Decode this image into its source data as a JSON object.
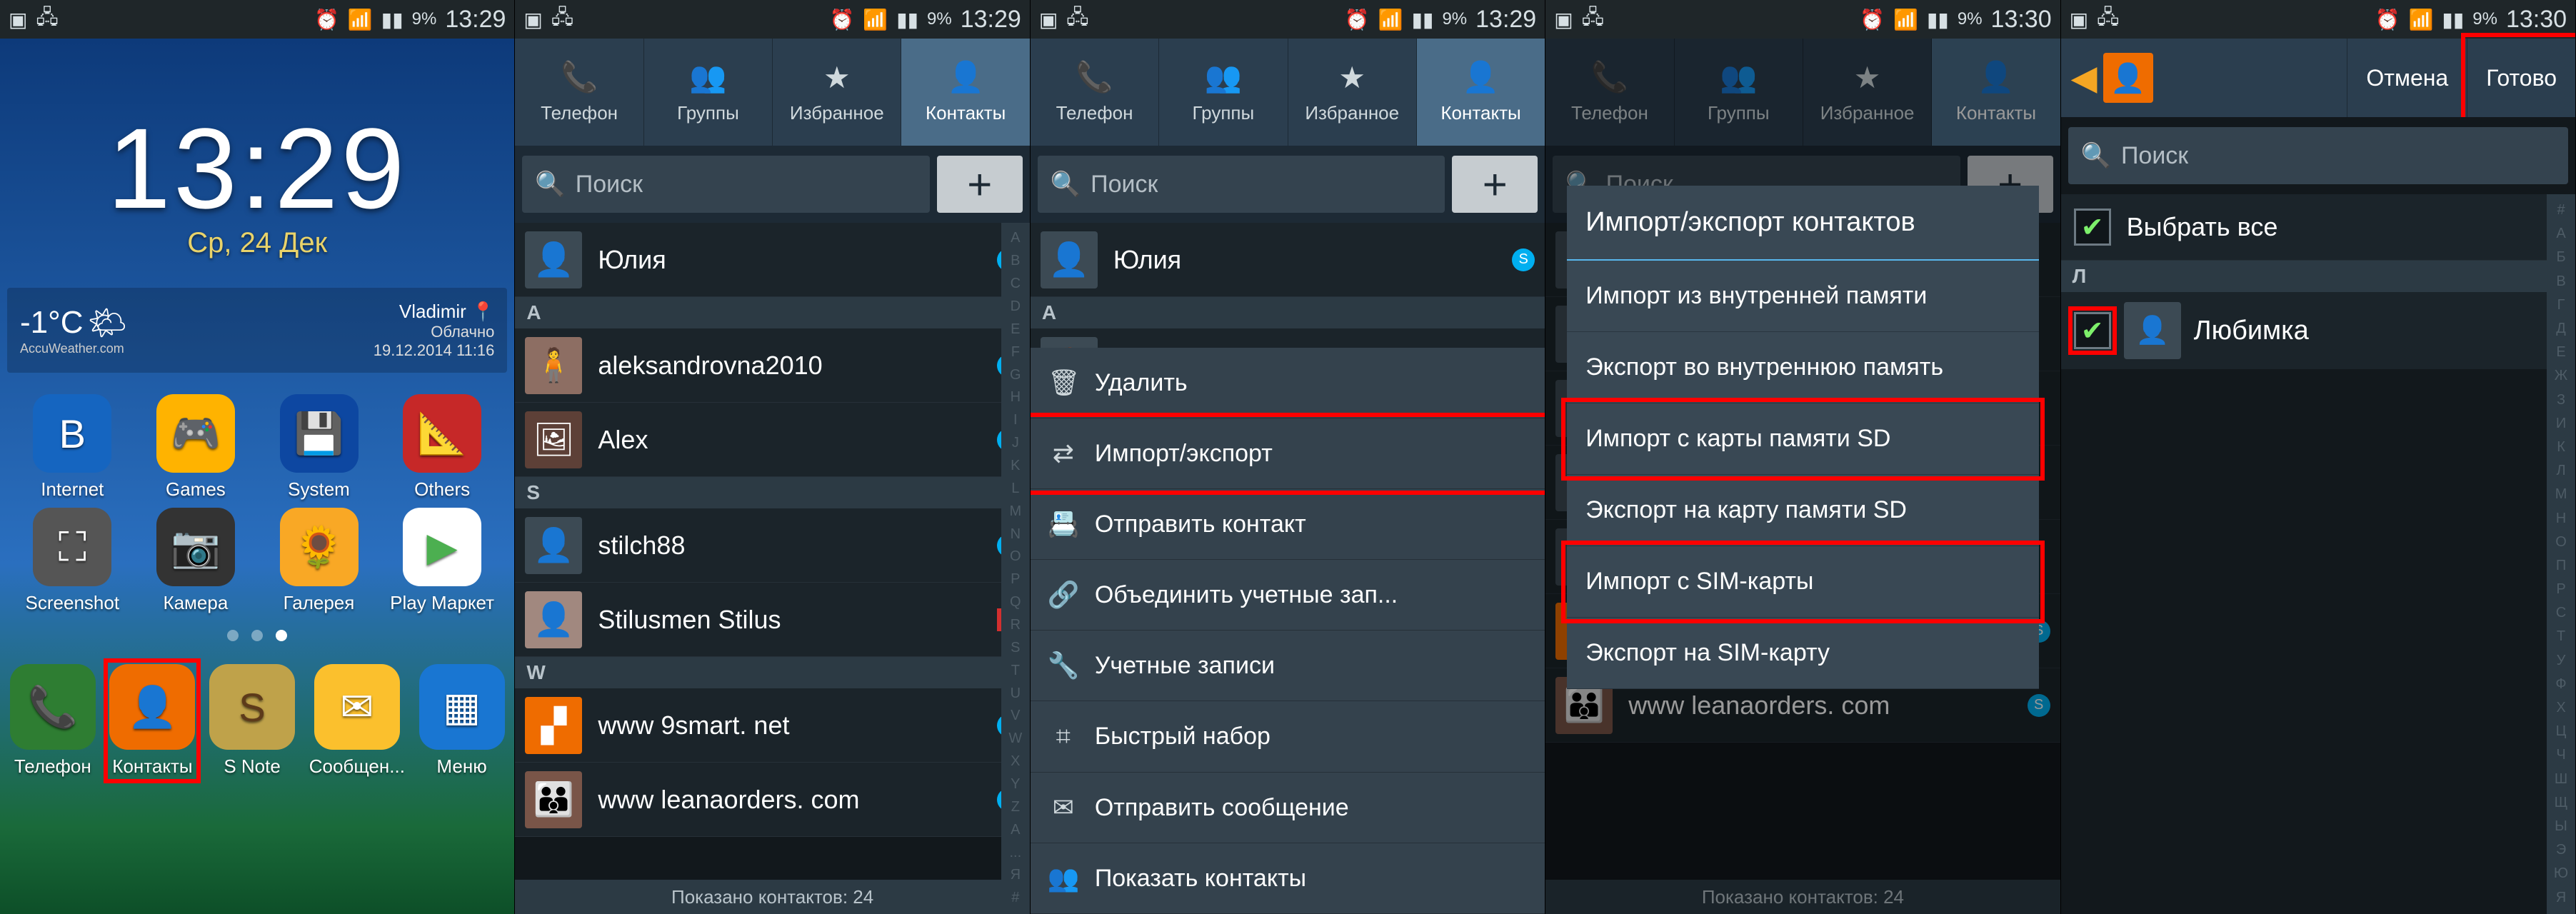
{
  "status": {
    "time1": "13:29",
    "time2": "13:29",
    "time3": "13:29",
    "time4": "13:30",
    "time5": "13:30",
    "battery": "9%"
  },
  "screen1": {
    "clock": "13:29",
    "date": "Ср, 24 Дек",
    "temp": "-1°C",
    "city": "Vladimir",
    "cond": "Облачно",
    "wsrc": "AccuWeather.com",
    "wts": "19.12.2014 11:16",
    "apps_row1": [
      "Internet",
      "Games",
      "System",
      "Others"
    ],
    "apps_row2": [
      "Screenshot",
      "Камера",
      "Галерея",
      "Play Маркет"
    ],
    "dock": [
      "Телефон",
      "Контакты",
      "S Note",
      "Сообщен...",
      "Меню"
    ]
  },
  "tabs": [
    "Телефон",
    "Группы",
    "Избранное",
    "Контакты"
  ],
  "search_placeholder": "Поиск",
  "contacts": {
    "top": "Юлия",
    "section": "A",
    "items": [
      "aleksandrovna2010",
      "Alex"
    ],
    "section_s": "S",
    "items_s": [
      "stilch88",
      "Stilusmen Stilus"
    ],
    "section_w": "W",
    "items_w": [
      "www 9smart. net",
      "www leanaorders. com"
    ],
    "footer": "Показано контактов: 24"
  },
  "menu": {
    "items": [
      "Удалить",
      "Импорт/экспорт",
      "Отправить контакт",
      "Объединить учетные зап...",
      "Учетные записи",
      "Быстрый набор",
      "Отправить сообщение",
      "Показать контакты"
    ]
  },
  "dialog": {
    "title": "Импорт/экспорт контактов",
    "items": [
      "Импорт из внутренней памяти",
      "Экспорт во внутреннюю память",
      "Импорт с карты памяти SD",
      "Экспорт на карту памяти SD",
      "Импорт с SIM-карты",
      "Экспорт на SIM-карту"
    ]
  },
  "screen5": {
    "cancel": "Отмена",
    "done": "Готово",
    "select_all": "Выбрать все",
    "section": "Л",
    "contact": "Любимка"
  },
  "index_letters": [
    "#",
    "А",
    "Б",
    "В",
    "Г",
    "Д",
    "Е",
    "Ж",
    "З",
    "И",
    "К",
    "Л",
    "М",
    "Н",
    "О",
    "П",
    "Р",
    "С",
    "Т",
    "У",
    "Ф",
    "Х",
    "Ц",
    "Ч",
    "Ш",
    "Щ",
    "Ы",
    "Э",
    "Ю",
    "Я"
  ],
  "index_letters_en": [
    "A",
    "B",
    "C",
    "D",
    "E",
    "F",
    "G",
    "H",
    "I",
    "J",
    "K",
    "L",
    "M",
    "N",
    "O",
    "P",
    "Q",
    "R",
    "S",
    "T",
    "U",
    "V",
    "W",
    "X",
    "Y",
    "Z",
    "А",
    "...",
    "Я",
    "#"
  ]
}
